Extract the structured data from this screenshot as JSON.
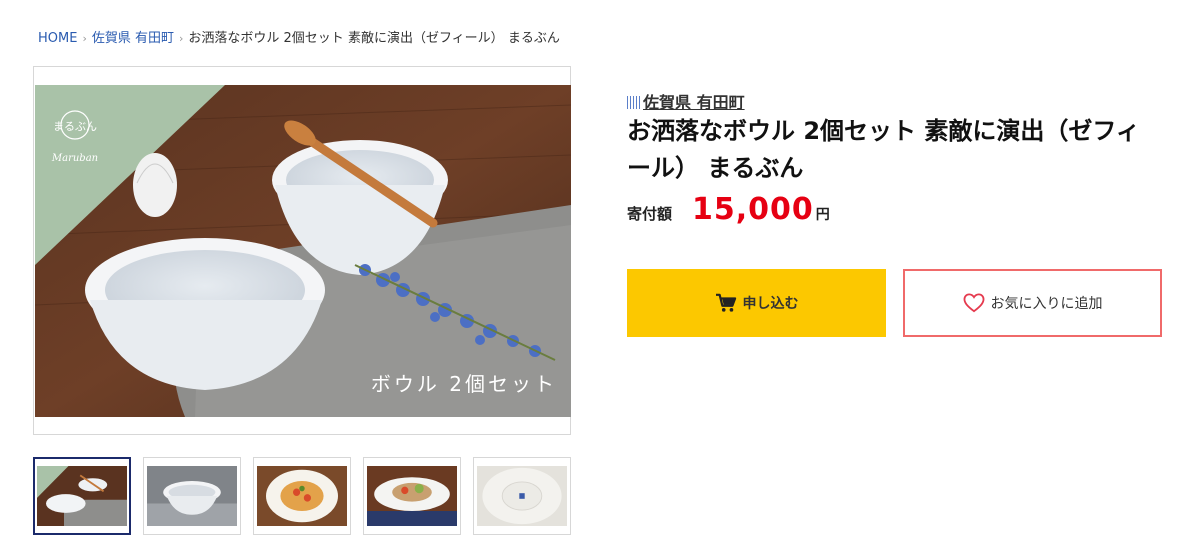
{
  "breadcrumb": {
    "home": "HOME",
    "region": "佐賀県 有田町",
    "current": "お洒落なボウル 2個セット 素敵に演出（ゼフィール） まるぶん"
  },
  "product": {
    "region": "佐賀県 有田町",
    "title": "お洒落なボウル 2個セット 素敵に演出（ゼフィール） まるぶん",
    "price_label": "寄付額",
    "price_value": "15,000",
    "price_unit": "円",
    "image_caption": "ボウル 2個セット",
    "brand_logo": "Maruban",
    "brand_logo_mark": "まるぶん"
  },
  "actions": {
    "apply": "申し込む",
    "favorite": "お気に入りに追加"
  },
  "thumbnails": [
    "bowls-set",
    "single-bowl",
    "pasta-dish",
    "salad-dish",
    "bowl-bottom"
  ],
  "colors": {
    "accent_yellow": "#fcc800",
    "price_red": "#e60012",
    "fav_border": "#f06a6a",
    "link_blue": "#2a5bb0"
  }
}
